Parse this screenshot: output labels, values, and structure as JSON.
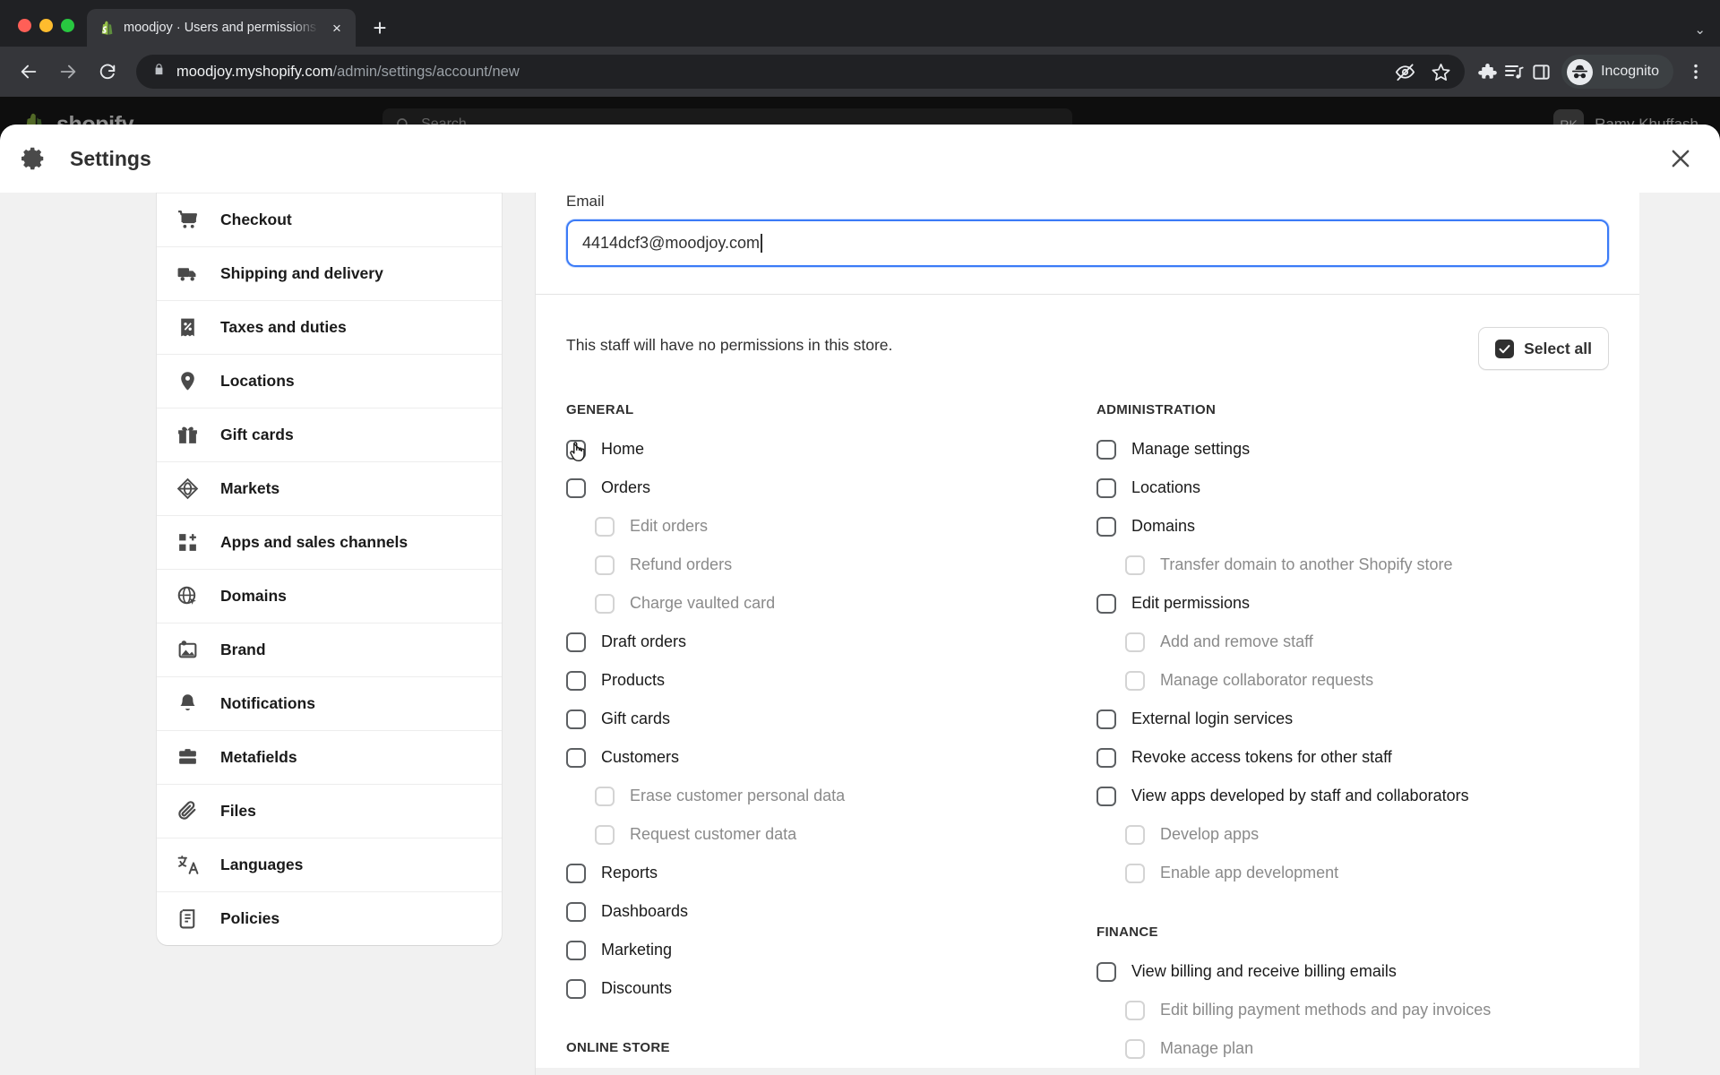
{
  "browser": {
    "tab": {
      "title": "moodjoy · Users and permissions",
      "favicon": "shopify-bag-icon",
      "close": "×"
    },
    "new_tab_label": "+",
    "tabstrip_chevron": "⌄",
    "url": {
      "host": "moodjoy.myshopify.com",
      "path": "/admin/settings/account/new"
    },
    "toolbar_icons": [
      "eye-off-icon",
      "bookmark-star-icon",
      "extensions-puzzle-icon",
      "media-list-icon",
      "side-panel-icon"
    ],
    "profile": {
      "label": "Incognito",
      "icon": "incognito-hat-icon"
    },
    "menu_icon": "kebab-menu-icon"
  },
  "page": {
    "brand": "shopify",
    "search_placeholder": "Search",
    "user": {
      "initials": "RK",
      "name": "Ramy Khuffash"
    }
  },
  "modal": {
    "title": "Settings",
    "gear_icon": "gear-icon",
    "close_icon": "close-icon"
  },
  "settings_nav": {
    "items": [
      {
        "label": "Checkout",
        "icon": "shopping-cart-icon"
      },
      {
        "label": "Shipping and delivery",
        "icon": "delivery-truck-icon"
      },
      {
        "label": "Taxes and duties",
        "icon": "tax-receipt-icon"
      },
      {
        "label": "Locations",
        "icon": "map-pin-icon"
      },
      {
        "label": "Gift cards",
        "icon": "gift-icon"
      },
      {
        "label": "Markets",
        "icon": "markets-globe-icon"
      },
      {
        "label": "Apps and sales channels",
        "icon": "apps-grid-plus-icon"
      },
      {
        "label": "Domains",
        "icon": "globe-cursor-icon"
      },
      {
        "label": "Brand",
        "icon": "brand-image-icon"
      },
      {
        "label": "Notifications",
        "icon": "bell-icon"
      },
      {
        "label": "Metafields",
        "icon": "metafields-drawer-icon"
      },
      {
        "label": "Files",
        "icon": "paperclip-icon"
      },
      {
        "label": "Languages",
        "icon": "translate-icon"
      },
      {
        "label": "Policies",
        "icon": "policy-scroll-icon"
      }
    ]
  },
  "form": {
    "email_label": "Email",
    "email_value": "4414dcf3@moodjoy.com",
    "email_placeholder": "Email"
  },
  "permissions": {
    "note": "This staff will have no permissions in this store.",
    "select_all_label": "Select all",
    "select_all_checked": true,
    "left_groups": [
      {
        "title": "GENERAL",
        "items": [
          {
            "label": "Home",
            "level": 0,
            "checked": false,
            "disabled": false
          },
          {
            "label": "Orders",
            "level": 0,
            "checked": false,
            "disabled": false
          },
          {
            "label": "Edit orders",
            "level": 1,
            "checked": false,
            "disabled": true
          },
          {
            "label": "Refund orders",
            "level": 1,
            "checked": false,
            "disabled": true
          },
          {
            "label": "Charge vaulted card",
            "level": 1,
            "checked": false,
            "disabled": true
          },
          {
            "label": "Draft orders",
            "level": 0,
            "checked": false,
            "disabled": false
          },
          {
            "label": "Products",
            "level": 0,
            "checked": false,
            "disabled": false
          },
          {
            "label": "Gift cards",
            "level": 0,
            "checked": false,
            "disabled": false
          },
          {
            "label": "Customers",
            "level": 0,
            "checked": false,
            "disabled": false
          },
          {
            "label": "Erase customer personal data",
            "level": 1,
            "checked": false,
            "disabled": true
          },
          {
            "label": "Request customer data",
            "level": 1,
            "checked": false,
            "disabled": true
          },
          {
            "label": "Reports",
            "level": 0,
            "checked": false,
            "disabled": false
          },
          {
            "label": "Dashboards",
            "level": 0,
            "checked": false,
            "disabled": false
          },
          {
            "label": "Marketing",
            "level": 0,
            "checked": false,
            "disabled": false
          },
          {
            "label": "Discounts",
            "level": 0,
            "checked": false,
            "disabled": false
          }
        ]
      },
      {
        "title": "ONLINE STORE",
        "items": []
      }
    ],
    "right_groups": [
      {
        "title": "ADMINISTRATION",
        "items": [
          {
            "label": "Manage settings",
            "level": 0,
            "checked": false,
            "disabled": false
          },
          {
            "label": "Locations",
            "level": 0,
            "checked": false,
            "disabled": false
          },
          {
            "label": "Domains",
            "level": 0,
            "checked": false,
            "disabled": false
          },
          {
            "label": "Transfer domain to another Shopify store",
            "level": 1,
            "checked": false,
            "disabled": true
          },
          {
            "label": "Edit permissions",
            "level": 0,
            "checked": false,
            "disabled": false
          },
          {
            "label": "Add and remove staff",
            "level": 1,
            "checked": false,
            "disabled": true
          },
          {
            "label": "Manage collaborator requests",
            "level": 1,
            "checked": false,
            "disabled": true
          },
          {
            "label": "External login services",
            "level": 0,
            "checked": false,
            "disabled": false
          },
          {
            "label": "Revoke access tokens for other staff",
            "level": 0,
            "checked": false,
            "disabled": false
          },
          {
            "label": "View apps developed by staff and collaborators",
            "level": 0,
            "checked": false,
            "disabled": false
          },
          {
            "label": "Develop apps",
            "level": 1,
            "checked": false,
            "disabled": true
          },
          {
            "label": "Enable app development",
            "level": 1,
            "checked": false,
            "disabled": true
          }
        ]
      },
      {
        "title": "FINANCE",
        "items": [
          {
            "label": "View billing and receive billing emails",
            "level": 0,
            "checked": false,
            "disabled": false
          },
          {
            "label": "Edit billing payment methods and pay invoices",
            "level": 1,
            "checked": false,
            "disabled": true
          },
          {
            "label": "Manage plan",
            "level": 1,
            "checked": false,
            "disabled": true
          }
        ]
      }
    ]
  },
  "colors": {
    "accent_focus": "#3b7bf7",
    "checkbox_checked": "#303030",
    "chrome_dark": "#202124",
    "chrome_toolbar": "#35363a"
  }
}
